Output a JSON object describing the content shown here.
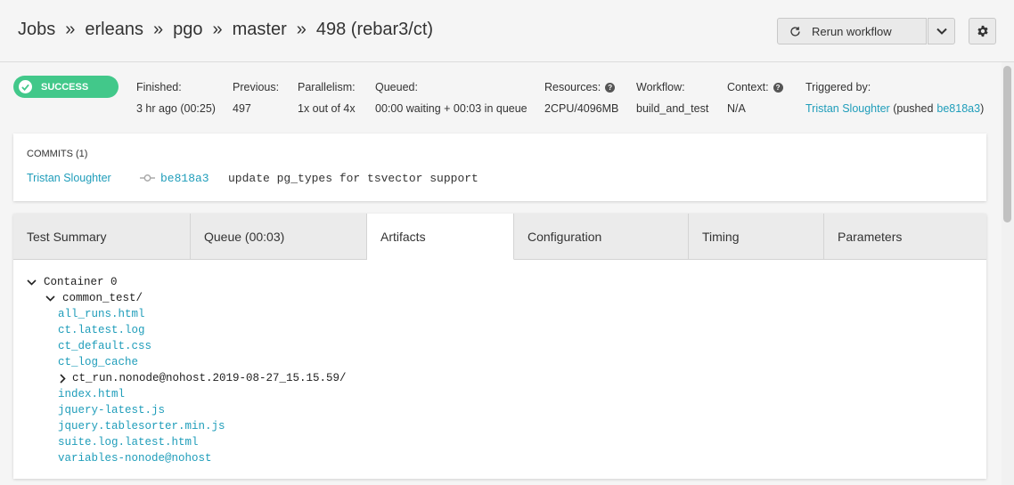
{
  "breadcrumb": [
    "Jobs",
    "erleans",
    "pgo",
    "master",
    "498 (rebar3/ct)"
  ],
  "breadcrumb_sep": "»",
  "actions": {
    "rerun_label": "Rerun workflow"
  },
  "status": {
    "label": "SUCCESS",
    "color": "#42c88a"
  },
  "info": {
    "finished": {
      "label": "Finished:",
      "value": "3 hr ago (00:25)"
    },
    "previous": {
      "label": "Previous:",
      "value": "497"
    },
    "parallelism": {
      "label": "Parallelism:",
      "value": "1x out of 4x"
    },
    "queued": {
      "label": "Queued:",
      "value": "00:00 waiting + 00:03 in queue"
    },
    "resources": {
      "label": "Resources:",
      "value": "2CPU/4096MB"
    },
    "workflow": {
      "label": "Workflow:",
      "value": "build_and_test"
    },
    "context": {
      "label": "Context:",
      "value": "N/A"
    },
    "triggered": {
      "label": "Triggered by:",
      "user": "Tristan Sloughter",
      "pushed_prefix": "(pushed",
      "commit": "be818a3",
      "suffix": ")"
    }
  },
  "commits": {
    "title": "COMMITS (1)",
    "author": "Tristan Sloughter",
    "hash": "be818a3",
    "message": "update pg_types for tsvector support"
  },
  "tabs": [
    {
      "label": "Test Summary",
      "active": false
    },
    {
      "label": "Queue (00:03)",
      "active": false
    },
    {
      "label": "Artifacts",
      "active": true
    },
    {
      "label": "Configuration",
      "active": false
    },
    {
      "label": "Timing",
      "active": false
    },
    {
      "label": "Parameters",
      "active": false
    }
  ],
  "artifacts": {
    "container": "Container 0",
    "folder": "common_test/",
    "files_before": [
      "all_runs.html",
      "ct.latest.log",
      "ct_default.css",
      "ct_log_cache"
    ],
    "subfolder": "ct_run.nonode@nohost.2019-08-27_15.15.59/",
    "files_after": [
      "index.html",
      "jquery-latest.js",
      "jquery.tablesorter.min.js",
      "suite.log.latest.html",
      "variables-nonode@nohost"
    ]
  },
  "colors": {
    "link": "#1f9dba",
    "accent_success": "#42c88a"
  }
}
